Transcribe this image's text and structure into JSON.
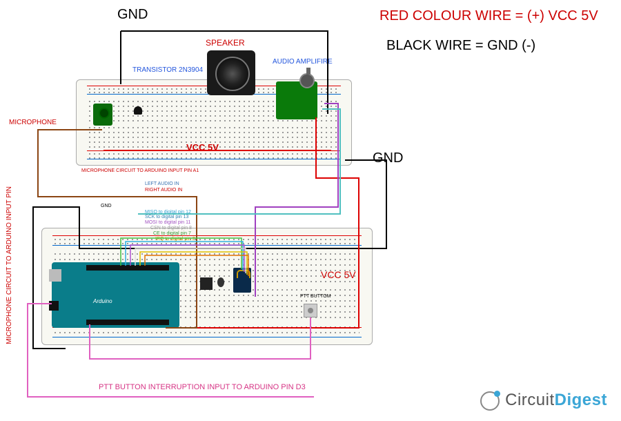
{
  "legend": {
    "vcc_wire": "RED COLOUR WIRE = (+) VCC 5V",
    "gnd_wire": "BLACK WIRE  = GND (-)"
  },
  "labels": {
    "gnd_top": "GND",
    "gnd_mid": "GND",
    "speaker": "SPEAKER",
    "audio_amp": "AUDIO AMPLIFIRE",
    "transistor": "TRANSISTOR 2N3904",
    "microphone": "MICROPHONE",
    "vcc5v_rail": "VCC 5V",
    "vcc5v_jump": "VCC 5V",
    "ptt_btn_note": "PTT BUTTOM",
    "arduino_name": "Arduino",
    "ptt_pin": "PTT BUTTON INTERRUPTION INPUT  TO ARDUINO PIN  D3",
    "mic_to_a1": "MICROPHONE CIRCUIT TO ARDUINO INPUT PIN  A1",
    "mic_vert": "MICROPHONE CIRCUIT TO ARDUINO INPUT PIN"
  },
  "pin_legend": {
    "left_audio": "LEFT AUDIO IN",
    "right_audio": "RIGHT AUDIO IN",
    "gnd": "GND",
    "miso": "MISO to digital pin 12",
    "sck": "SCK to digital pin 13",
    "mosi": "MOSI to digital pin 11",
    "csn": "CSN to digital pin 8",
    "ce": "CE to digital pin 7",
    "irq": "IRQ to digital pin 2"
  }
}
